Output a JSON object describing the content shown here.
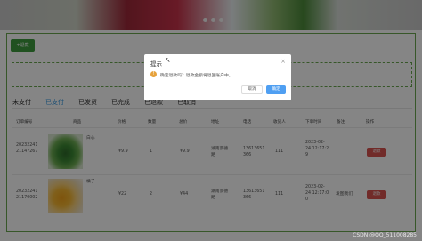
{
  "banner": {
    "dots": 3
  },
  "toolbar": {
    "refund_label": "+退款"
  },
  "tabs": [
    "未支付",
    "已支付",
    "已发货",
    "已完成",
    "已退款",
    "已取消"
  ],
  "active_tab_index": 1,
  "table": {
    "headers": [
      "订单编号",
      "商品",
      "价格",
      "数量",
      "总价",
      "地址",
      "电话",
      "收货人",
      "下单时间",
      "备注",
      "操作"
    ],
    "rows": [
      {
        "order_no_1": "20232241",
        "order_no_2": "21147267",
        "product": "白心",
        "price": "¥9.9",
        "qty": "1",
        "total": "¥9.9",
        "addr_1": "湖南景德",
        "addr_2": "路",
        "phone_1": "13613651",
        "phone_2": "366",
        "receiver": "111",
        "time_1": "2023-02-",
        "time_2": "24 12:17:2",
        "time_3": "9",
        "remark": "",
        "action": "退款"
      },
      {
        "order_no_1": "20232241",
        "order_no_2": "21170002",
        "product": "橘子",
        "price": "¥22",
        "qty": "2",
        "total": "¥44",
        "addr_1": "湖南景德",
        "addr_2": "路",
        "phone_1": "13613651",
        "phone_2": "366",
        "receiver": "111",
        "time_1": "2023-02-",
        "time_2": "24 12:17:0",
        "time_3": "0",
        "remark": "发图我们",
        "action": "退款"
      }
    ]
  },
  "dialog": {
    "title": "提示",
    "close_glyph": "×",
    "icon_glyph": "!",
    "message": "确定退款吗？退款金额将退回账户中。",
    "cancel_label": "取消",
    "ok_label": "确定"
  },
  "watermark": "CSDN @QQ_511008285",
  "colors": {
    "accent": "#3e9b3e",
    "tab_active": "#3b9be0",
    "danger": "#d9534f",
    "primary": "#4f9ff2",
    "warning": "#e6a23c"
  }
}
